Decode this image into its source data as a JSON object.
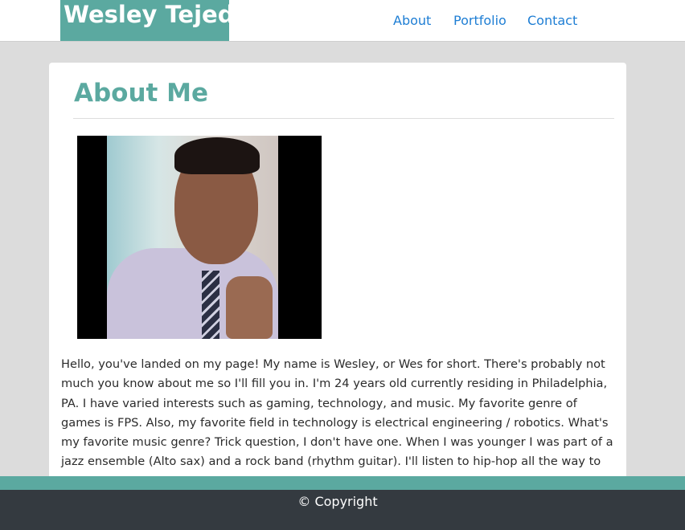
{
  "header": {
    "brand": "Wesley Tejeda",
    "nav": [
      {
        "label": "About"
      },
      {
        "label": "Portfolio"
      },
      {
        "label": "Contact"
      }
    ]
  },
  "main": {
    "title": "About Me",
    "photo_subject": "portrait photo of a man in a lavender shirt and striped tie giving a thumbs up",
    "paragraph": "Hello, you've landed on my page! My name is Wesley, or Wes for short. There's probably not much you know about me so I'll fill you in. I'm 24 years old currently residing in Philadelphia, PA. I have varied interests such as gaming, technology, and music. My favorite genre of games is FPS. Also, my favorite field in technology is electrical engineering / robotics. What's my favorite music genre? Trick question, I don't have one. When I was younger I was part of a jazz ensemble (Alto sax) and a rock band (rhythm guitar). I'll listen to hip-hop all the way to synthwave and"
  },
  "footer": {
    "copyright": "© Copyright"
  },
  "colors": {
    "accent": "#5ba9a0",
    "link": "#1e7ed4",
    "footer_bg": "#343a40",
    "page_bg": "#dcdcdc"
  }
}
